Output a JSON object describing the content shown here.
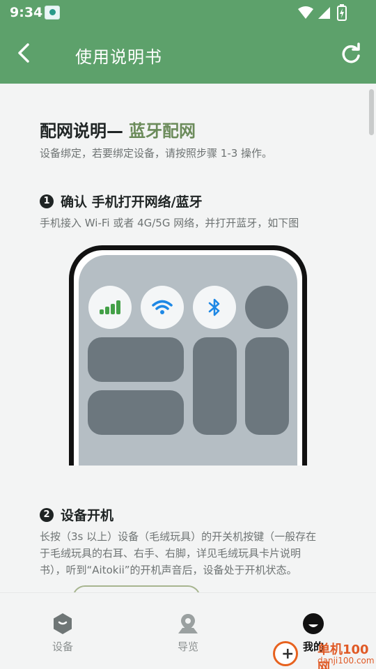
{
  "status_bar": {
    "time": "9:34"
  },
  "app_bar": {
    "title": "使用说明书"
  },
  "content": {
    "heading": "配网说明—",
    "heading_accent": "蓝牙配网",
    "subtitle": "设备绑定，若要绑定设备，请按照步骤 1-3 操作。",
    "step1": {
      "number": "1",
      "title": "确认 手机打开网络/蓝牙",
      "desc": "手机接入 Wi-Fi 或者 4G/5G 网络，并打开蓝牙，如下图"
    },
    "step2": {
      "number": "2",
      "title": "设备开机",
      "desc_line1": "长按（3s 以上）设备（毛绒玩具）的开关机按键（一般存在",
      "desc_line2": "于毛绒玩具的右耳、右手、右脚，详见毛绒玩具卡片说明",
      "desc_line3": "书），听到“Aitokii”的开机声音后，设备处于开机状态。"
    }
  },
  "colors": {
    "primary_green": "#5da16b",
    "accent_olive": "#6b8b5a",
    "qs_icon_blue": "#1e88e5",
    "qs_icon_green": "#43a047"
  },
  "bottom_nav": {
    "items": [
      {
        "label": "设备",
        "icon": "device-hexagon-icon",
        "active": false
      },
      {
        "label": "导览",
        "icon": "map-pin-icon",
        "active": false
      },
      {
        "label": "我的",
        "icon": "smiley-profile-icon",
        "active": true
      }
    ]
  },
  "watermark": {
    "brand": "单机100网",
    "domain": "danji100.com"
  }
}
